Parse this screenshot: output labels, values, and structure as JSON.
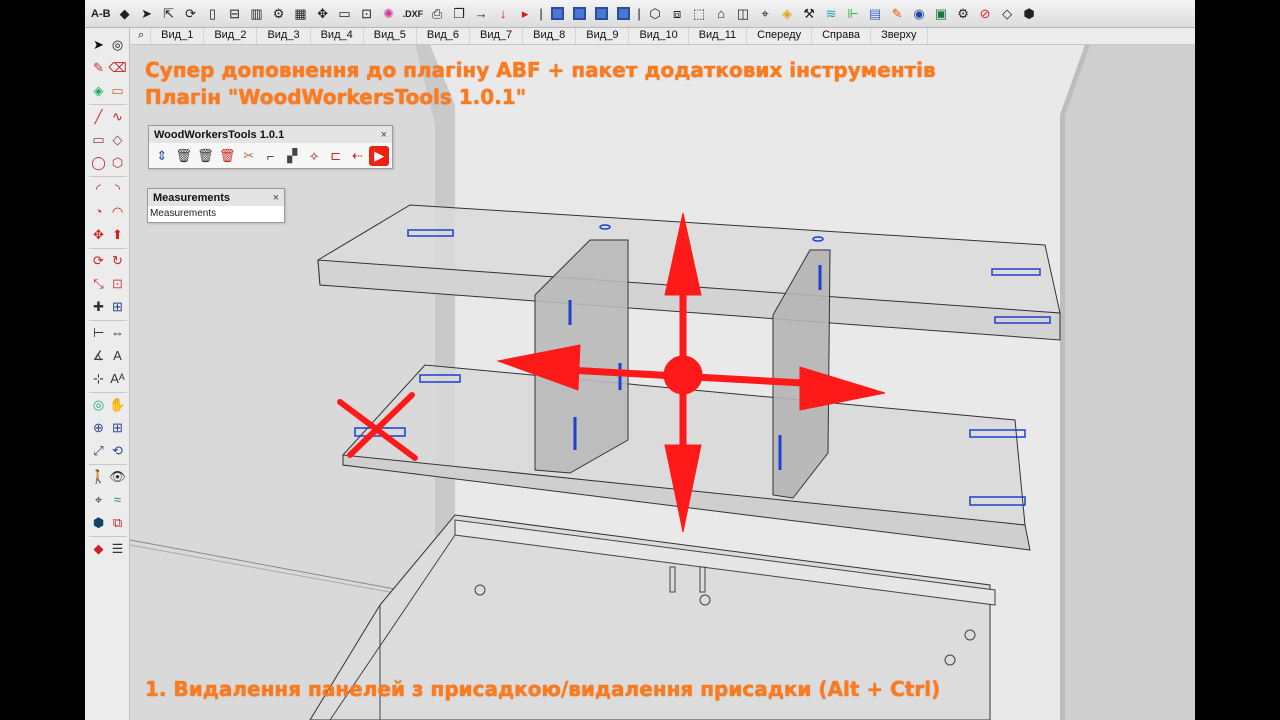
{
  "top_toolbar": {
    "text_tools": {
      "ab_label": "A-B",
      "dxf_label": ".DXF"
    },
    "icons": [
      "tag-icon",
      "select-arrow-icon",
      "orbit-icon",
      "rotate-icon",
      "panel-icon",
      "split-icon",
      "grid-icon",
      "gear-icon",
      "table-icon",
      "move-icon",
      "rectangle-icon",
      "dimension-icon",
      "color-wheel-icon",
      "dxf-icon",
      "printer-icon",
      "cube-icon",
      "arrow-right-icon",
      "arrow-down-icon",
      "play-icon",
      "view-front-icon",
      "view-back-icon",
      "view-left-icon",
      "view-right-icon",
      "iso-icon",
      "box-top-icon",
      "box-side-icon",
      "box-open-icon",
      "camera-icon",
      "paint-bucket-icon",
      "measure-icon",
      "wave-icon",
      "ruler-icon",
      "tag-strip-icon",
      "pencil-icon",
      "eye-icon",
      "excel-icon",
      "settings-icon",
      "no-entry-icon",
      "shape-icon",
      "component-icon"
    ]
  },
  "scenes": {
    "search_icon": "search-icon",
    "tabs": [
      "Вид_1",
      "Вид_2",
      "Вид_3",
      "Вид_4",
      "Вид_5",
      "Вид_6",
      "Вид_7",
      "Вид_8",
      "Вид_9",
      "Вид_10",
      "Вид_11",
      "Спереду",
      "Справа",
      "Зверху"
    ]
  },
  "left_toolbar": {
    "icons": [
      "select-icon",
      "lasso-icon",
      "paint-icon",
      "eraser-icon",
      "component-icon",
      "tape-icon",
      "line-icon",
      "freehand-icon",
      "rectangle-icon",
      "rotated-rect-icon",
      "circle-icon",
      "polygon-icon",
      "arc-icon",
      "arc2-icon",
      "pie-icon",
      "three-point-arc-icon",
      "move-icon",
      "push-pull-icon",
      "rotate-icon",
      "follow-me-icon",
      "scale-icon",
      "offset-icon",
      "axes-icon",
      "section-icon",
      "tape-measure-icon",
      "dimension-icon",
      "protractor-icon",
      "text-icon",
      "axis-icon",
      "3d-text-icon",
      "orbit-icon",
      "pan-icon",
      "zoom-icon",
      "zoom-window-icon",
      "zoom-extents-icon",
      "previous-icon",
      "walk-icon",
      "look-icon",
      "position-camera-icon",
      "sandbox-icon",
      "warehouse-icon",
      "extension-icon",
      "ruby-icon",
      "layers-icon"
    ]
  },
  "captions": {
    "title_line1": "Супер доповнення до плагіну ABF + пакет додаткових інструментів",
    "title_line2": "Плагін \"WoodWorkersTools 1.0.1\"",
    "bottom": "1. Видалення панелей з присадкою/видалення присадки (Alt + Ctrl)"
  },
  "wwt_panel": {
    "title": "WoodWorkersTools 1.0.1",
    "close": "×",
    "icons": [
      "panel-move-icon",
      "trash-hardware-icon",
      "trash-panel-icon",
      "trash-red-icon",
      "tool-wrench-icon",
      "bracket-icon",
      "stripe-icon",
      "replace-label-icon",
      "hardware-red-icon",
      "arrow-panel-icon",
      "youtube-icon"
    ]
  },
  "measurements_panel": {
    "title": "Measurements",
    "close": "×",
    "field": "Measurements"
  },
  "colors": {
    "caption_orange": "#ff7a1a",
    "arrow_red": "#ff1a1a",
    "hardware_blue": "#1f3fd0",
    "toolbar_bg": "#ececec"
  }
}
